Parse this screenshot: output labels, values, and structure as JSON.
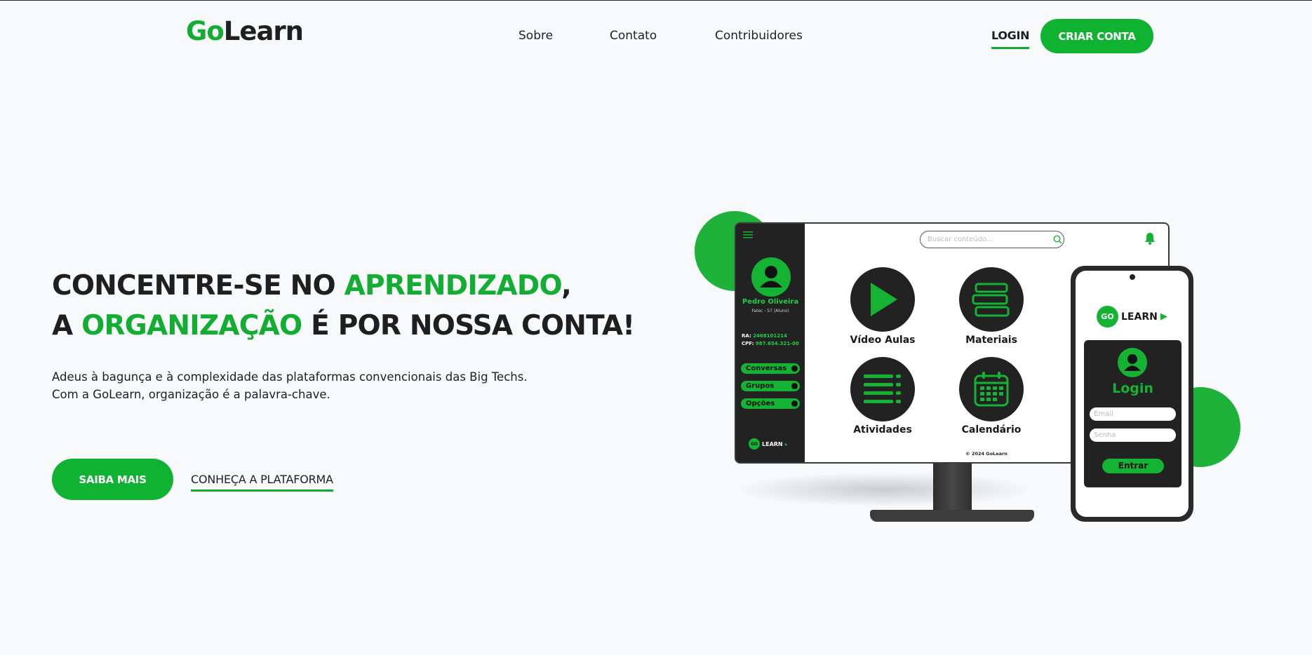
{
  "header": {
    "logo_go": "Go",
    "logo_learn": "Learn",
    "nav": [
      "Sobre",
      "Contato",
      "Contribuidores"
    ],
    "login": "LOGIN",
    "signup": "CRIAR CONTA"
  },
  "hero": {
    "line1_a": "CONCENTRE-SE NO ",
    "line1_hl": "APRENDIZADO",
    "line1_b": ",",
    "line2_a": "A ",
    "line2_hl": "ORGANIZAÇÃO",
    "line2_b": " É POR NOSSA CONTA!",
    "sub1": "Adeus à bagunça e à complexidade das plataformas convencionais das Big Techs.",
    "sub2": "Com a GoLearn, organização é a palavra-chave.",
    "cta_primary": "SAIBA MAIS",
    "cta_secondary": "CONHEÇA A PLATAFORMA"
  },
  "monitor": {
    "user_name": "Pedro Oliveira",
    "user_sub": "Fatec - S7 (Aluno)",
    "ra_label": "RA:",
    "ra_value": "2468101214",
    "cpf_label": "CPF:",
    "cpf_value": "987.654.321-00",
    "menu": [
      "Conversas",
      "Grupos",
      "Opções"
    ],
    "mini_logo_go": "GO",
    "mini_logo_learn": "LEARN",
    "search_placeholder": "Buscar conteúdo...",
    "tiles": [
      "Vídeo Aulas",
      "Materiais",
      "Atividades",
      "Calendário"
    ],
    "footer": "© 2024 GoLearn"
  },
  "phone": {
    "logo_go": "GO",
    "logo_learn": "LEARN",
    "title": "Login",
    "email_placeholder": "Email",
    "password_placeholder": "Senha",
    "submit": "Entrar"
  },
  "colors": {
    "brand_green": "#13ad33",
    "dark": "#1f1f1f",
    "background": "#f8f9fb"
  }
}
